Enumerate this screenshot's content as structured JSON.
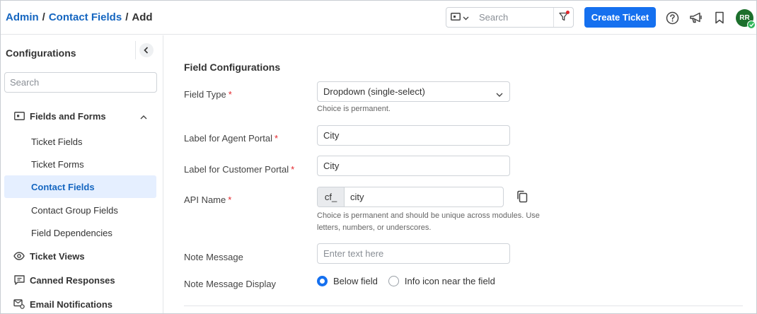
{
  "breadcrumb": {
    "admin": "Admin",
    "sep1": "/",
    "contact_fields": "Contact Fields",
    "sep2": "/",
    "current": "Add"
  },
  "header": {
    "search_placeholder": "Search",
    "create_ticket": "Create Ticket",
    "avatar_initials": "RR",
    "icons": [
      "ticket-type-icon",
      "chevron-down-icon",
      "filter-icon",
      "help-icon",
      "megaphone-icon",
      "bookmark-icon"
    ]
  },
  "sidebar": {
    "title": "Configurations",
    "search_placeholder": "Search",
    "groups": [
      {
        "label": "Fields and Forms",
        "icon": "fields-forms-icon",
        "expanded": true,
        "items": [
          {
            "label": "Ticket Fields"
          },
          {
            "label": "Ticket Forms"
          },
          {
            "label": "Contact Fields",
            "active": true
          },
          {
            "label": "Contact Group Fields"
          },
          {
            "label": "Field Dependencies"
          }
        ]
      },
      {
        "label": "Ticket Views",
        "icon": "eye-icon"
      },
      {
        "label": "Canned Responses",
        "icon": "chat-icon"
      },
      {
        "label": "Email Notifications",
        "icon": "email-notification-icon"
      }
    ]
  },
  "form": {
    "section_title": "Field Configurations",
    "field_type": {
      "label": "Field Type",
      "required_mark": "*",
      "value": "Dropdown (single-select)",
      "hint": "Choice is permanent."
    },
    "agent_label": {
      "label": "Label for Agent Portal",
      "required_mark": "*",
      "value": "City"
    },
    "customer_label": {
      "label": "Label for Customer Portal",
      "required_mark": "*",
      "value": "City"
    },
    "api_name": {
      "label": "API Name",
      "required_mark": "*",
      "prefix": "cf_",
      "value": "city",
      "hint": "Choice is permanent and should be unique across modules. Use letters, numbers, or underscores."
    },
    "note_message": {
      "label": "Note Message",
      "placeholder": "Enter text here"
    },
    "note_display": {
      "label": "Note Message Display",
      "options": [
        {
          "label": "Below field",
          "checked": true
        },
        {
          "label": "Info icon near the field",
          "checked": false
        }
      ]
    }
  },
  "colors": {
    "primary": "#1570ef",
    "link": "#1566c0",
    "required": "#e3262b",
    "avatar": "#1c6f2c",
    "active_bg": "#e5efff"
  }
}
